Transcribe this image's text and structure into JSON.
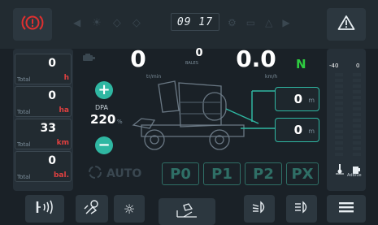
{
  "top": {
    "clock": "09 17",
    "dim_icons": [
      "arrow-left-icon",
      "light-icon",
      "diamond-icon",
      "diamond-icon",
      "wrench-icon",
      "battery-icon",
      "warning-triangle-icon",
      "arrow-right-icon"
    ]
  },
  "left_totals": [
    {
      "value": "0",
      "label": "Total",
      "unit": "h"
    },
    {
      "value": "0",
      "label": "Total",
      "unit": "ha"
    },
    {
      "value": "33",
      "label": "Total",
      "unit": "km"
    },
    {
      "value": "0",
      "label": "Total",
      "unit": "bal."
    }
  ],
  "speeds": {
    "rotor_value": "0",
    "rotor_unit": "tr/min",
    "bales_value": "0",
    "bales_unit": "BALES",
    "speed_value": "0.0",
    "speed_unit": "km/h",
    "gear": "N"
  },
  "dpa": {
    "label": "DPA",
    "value": "220",
    "unit": "%",
    "plus": "+",
    "minus": "−"
  },
  "measures": [
    {
      "value": "0",
      "unit": "m"
    },
    {
      "value": "0",
      "unit": "m"
    }
  ],
  "auto_label": "AUTO",
  "programs": [
    "P0",
    "P1",
    "P2",
    "PX"
  ],
  "right_gauges": {
    "left_label": "-40",
    "right_label": "0",
    "adblue_label": "AdBlue"
  },
  "colors": {
    "accent": "#2fb7a2",
    "alert": "#e03030",
    "gear": "#2ecc40",
    "dim": "#3a4750"
  }
}
